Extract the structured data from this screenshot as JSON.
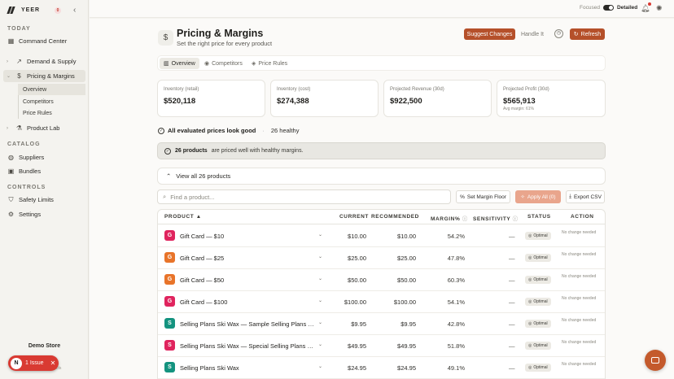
{
  "brand": {
    "name": "YEER",
    "badge": "0"
  },
  "sidebar": {
    "sections": {
      "today": "TODAY",
      "catalog": "CATALOG",
      "controls": "CONTROLS"
    },
    "items": [
      {
        "label": "Command Center",
        "icon": "grid-icon"
      },
      {
        "label": "Demand & Supply",
        "icon": "trend-icon"
      },
      {
        "label": "Pricing & Margins",
        "icon": "dollar-icon"
      },
      {
        "label": "Product Lab",
        "icon": "flask-icon"
      },
      {
        "label": "Suppliers",
        "icon": "globe-icon"
      },
      {
        "label": "Bundles",
        "icon": "box-icon"
      },
      {
        "label": "Safety Limits",
        "icon": "shield-icon"
      },
      {
        "label": "Settings",
        "icon": "gear-icon"
      }
    ],
    "sub_items": [
      {
        "label": "Overview"
      },
      {
        "label": "Competitors"
      },
      {
        "label": "Price Rules"
      }
    ],
    "store": {
      "name": "Demo Store",
      "sub": "...ucts"
    },
    "issue": {
      "label": "1 Issue"
    }
  },
  "topbar": {
    "focused": "Focused",
    "detailed": "Detailed"
  },
  "header": {
    "title": "Pricing & Margins",
    "subtitle": "Set the right price for every product",
    "suggest": "Suggest Changes",
    "handle": "Handle It",
    "refresh": "Refresh"
  },
  "tabs": [
    {
      "label": "Overview"
    },
    {
      "label": "Competitors"
    },
    {
      "label": "Price Rules"
    }
  ],
  "cards": [
    {
      "label": "Inventory (retail)",
      "value": "$520,118",
      "note": ""
    },
    {
      "label": "Inventory (cost)",
      "value": "$274,388",
      "note": ""
    },
    {
      "label": "Projected Revenue (30d)",
      "value": "$922,500",
      "note": ""
    },
    {
      "label": "Projected Profit (30d)",
      "value": "$565,913",
      "note": "Avg margin: 61%"
    }
  ],
  "eval": {
    "status": "All evaluated prices look good",
    "healthy": "26 healthy"
  },
  "banner": {
    "count": "26 products",
    "text": "are priced well with healthy margins."
  },
  "viewall": "View all 26 products",
  "search": {
    "placeholder": "Find a product..."
  },
  "tools": {
    "margin_floor": "Set Margin Floor",
    "apply_all": "Apply All (0)",
    "export": "Export CSV"
  },
  "table": {
    "headers": {
      "product": "PRODUCT ▲",
      "current": "CURRENT",
      "recommended": "RECOMMENDED",
      "margin": "MARGIN%",
      "sensitivity": "SENSITIVITY",
      "status": "STATUS",
      "action": "ACTION"
    },
    "rows": [
      {
        "initial": "G",
        "color": "#e0245e",
        "name": "Gift Card — $10",
        "current": "$10.00",
        "recommended": "$10.00",
        "margin": "54.2%",
        "sensitivity": "—",
        "status": "Optimal",
        "action": "No change needed"
      },
      {
        "initial": "G",
        "color": "#e8742a",
        "name": "Gift Card — $25",
        "current": "$25.00",
        "recommended": "$25.00",
        "margin": "47.8%",
        "sensitivity": "—",
        "status": "Optimal",
        "action": "No change needed"
      },
      {
        "initial": "G",
        "color": "#e8742a",
        "name": "Gift Card — $50",
        "current": "$50.00",
        "recommended": "$50.00",
        "margin": "60.3%",
        "sensitivity": "—",
        "status": "Optimal",
        "action": "No change needed"
      },
      {
        "initial": "G",
        "color": "#e0245e",
        "name": "Gift Card — $100",
        "current": "$100.00",
        "recommended": "$100.00",
        "margin": "54.1%",
        "sensitivity": "—",
        "status": "Optimal",
        "action": "No change needed"
      },
      {
        "initial": "S",
        "color": "#14937f",
        "name": "Selling Plans Ski Wax — Sample Selling Plans Ski Wax",
        "current": "$9.95",
        "recommended": "$9.95",
        "margin": "42.8%",
        "sensitivity": "—",
        "status": "Optimal",
        "action": "No change needed"
      },
      {
        "initial": "S",
        "color": "#e0245e",
        "name": "Selling Plans Ski Wax — Special Selling Plans Ski Wax",
        "current": "$49.95",
        "recommended": "$49.95",
        "margin": "51.8%",
        "sensitivity": "—",
        "status": "Optimal",
        "action": "No change needed"
      },
      {
        "initial": "S",
        "color": "#14937f",
        "name": "Selling Plans Ski Wax",
        "current": "$24.95",
        "recommended": "$24.95",
        "margin": "49.1%",
        "sensitivity": "—",
        "status": "Optimal",
        "action": "No change needed"
      }
    ]
  }
}
